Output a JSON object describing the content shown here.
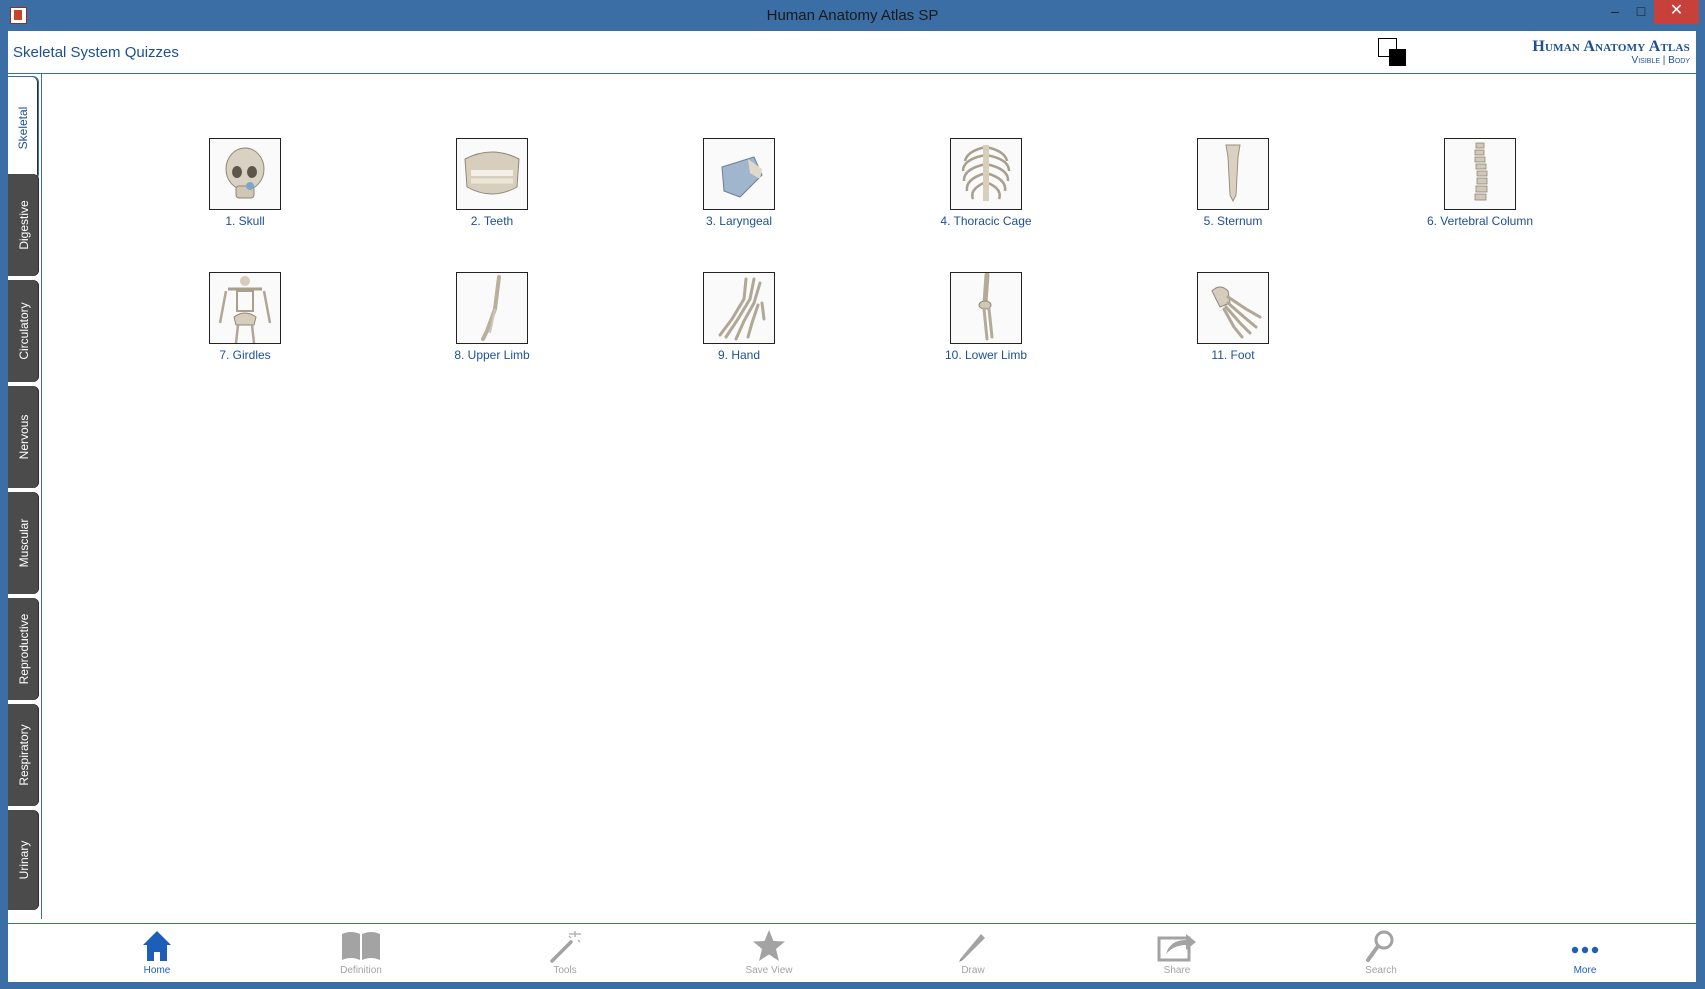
{
  "window": {
    "title": "Human Anatomy Atlas SP",
    "minimize": "–",
    "maximize": "□",
    "close": "✕"
  },
  "header": {
    "title": "Skeletal System Quizzes",
    "brand_main": "Human Anatomy Atlas",
    "brand_sub": "Visible | Body"
  },
  "sidetabs": [
    {
      "label": "Skeletal",
      "active": true
    },
    {
      "label": "Digestive",
      "active": false
    },
    {
      "label": "Circulatory",
      "active": false
    },
    {
      "label": "Nervous",
      "active": false
    },
    {
      "label": "Muscular",
      "active": false
    },
    {
      "label": "Reproductive",
      "active": false
    },
    {
      "label": "Respiratory",
      "active": false
    },
    {
      "label": "Urinary",
      "active": false
    }
  ],
  "quizzes": [
    {
      "label": "1. Skull",
      "icon": "skull-image"
    },
    {
      "label": "2. Teeth",
      "icon": "teeth-image"
    },
    {
      "label": "3. Laryngeal",
      "icon": "larynx-image"
    },
    {
      "label": "4. Thoracic Cage",
      "icon": "ribcage-image"
    },
    {
      "label": "5. Sternum",
      "icon": "sternum-image"
    },
    {
      "label": "6. Vertebral Column",
      "icon": "spine-image"
    },
    {
      "label": "7. Girdles",
      "icon": "skeleton-image"
    },
    {
      "label": "8. Upper Limb",
      "icon": "arm-bone-image"
    },
    {
      "label": "9. Hand",
      "icon": "hand-bones-image"
    },
    {
      "label": "10. Lower Limb",
      "icon": "leg-bone-image"
    },
    {
      "label": "11. Foot",
      "icon": "foot-bones-image"
    }
  ],
  "toolbar": [
    {
      "label": "Home",
      "icon": "home-icon",
      "active": true
    },
    {
      "label": "Definition",
      "icon": "book-icon",
      "active": false
    },
    {
      "label": "Tools",
      "icon": "magic-wand-icon",
      "active": false
    },
    {
      "label": "Save View",
      "icon": "star-icon",
      "active": false
    },
    {
      "label": "Draw",
      "icon": "pencil-icon",
      "active": false
    },
    {
      "label": "Share",
      "icon": "share-icon",
      "active": false
    },
    {
      "label": "Search",
      "icon": "search-icon",
      "active": false
    },
    {
      "label": "More",
      "icon": "more-icon",
      "active": true
    }
  ],
  "colors": {
    "accent": "#1d4f96",
    "active_tool": "#1d5fb8",
    "inactive_tool": "#a3a3a3",
    "tab_dark": "#4b4b4b",
    "frame": "#3a6ea5",
    "close": "#c7403a"
  }
}
